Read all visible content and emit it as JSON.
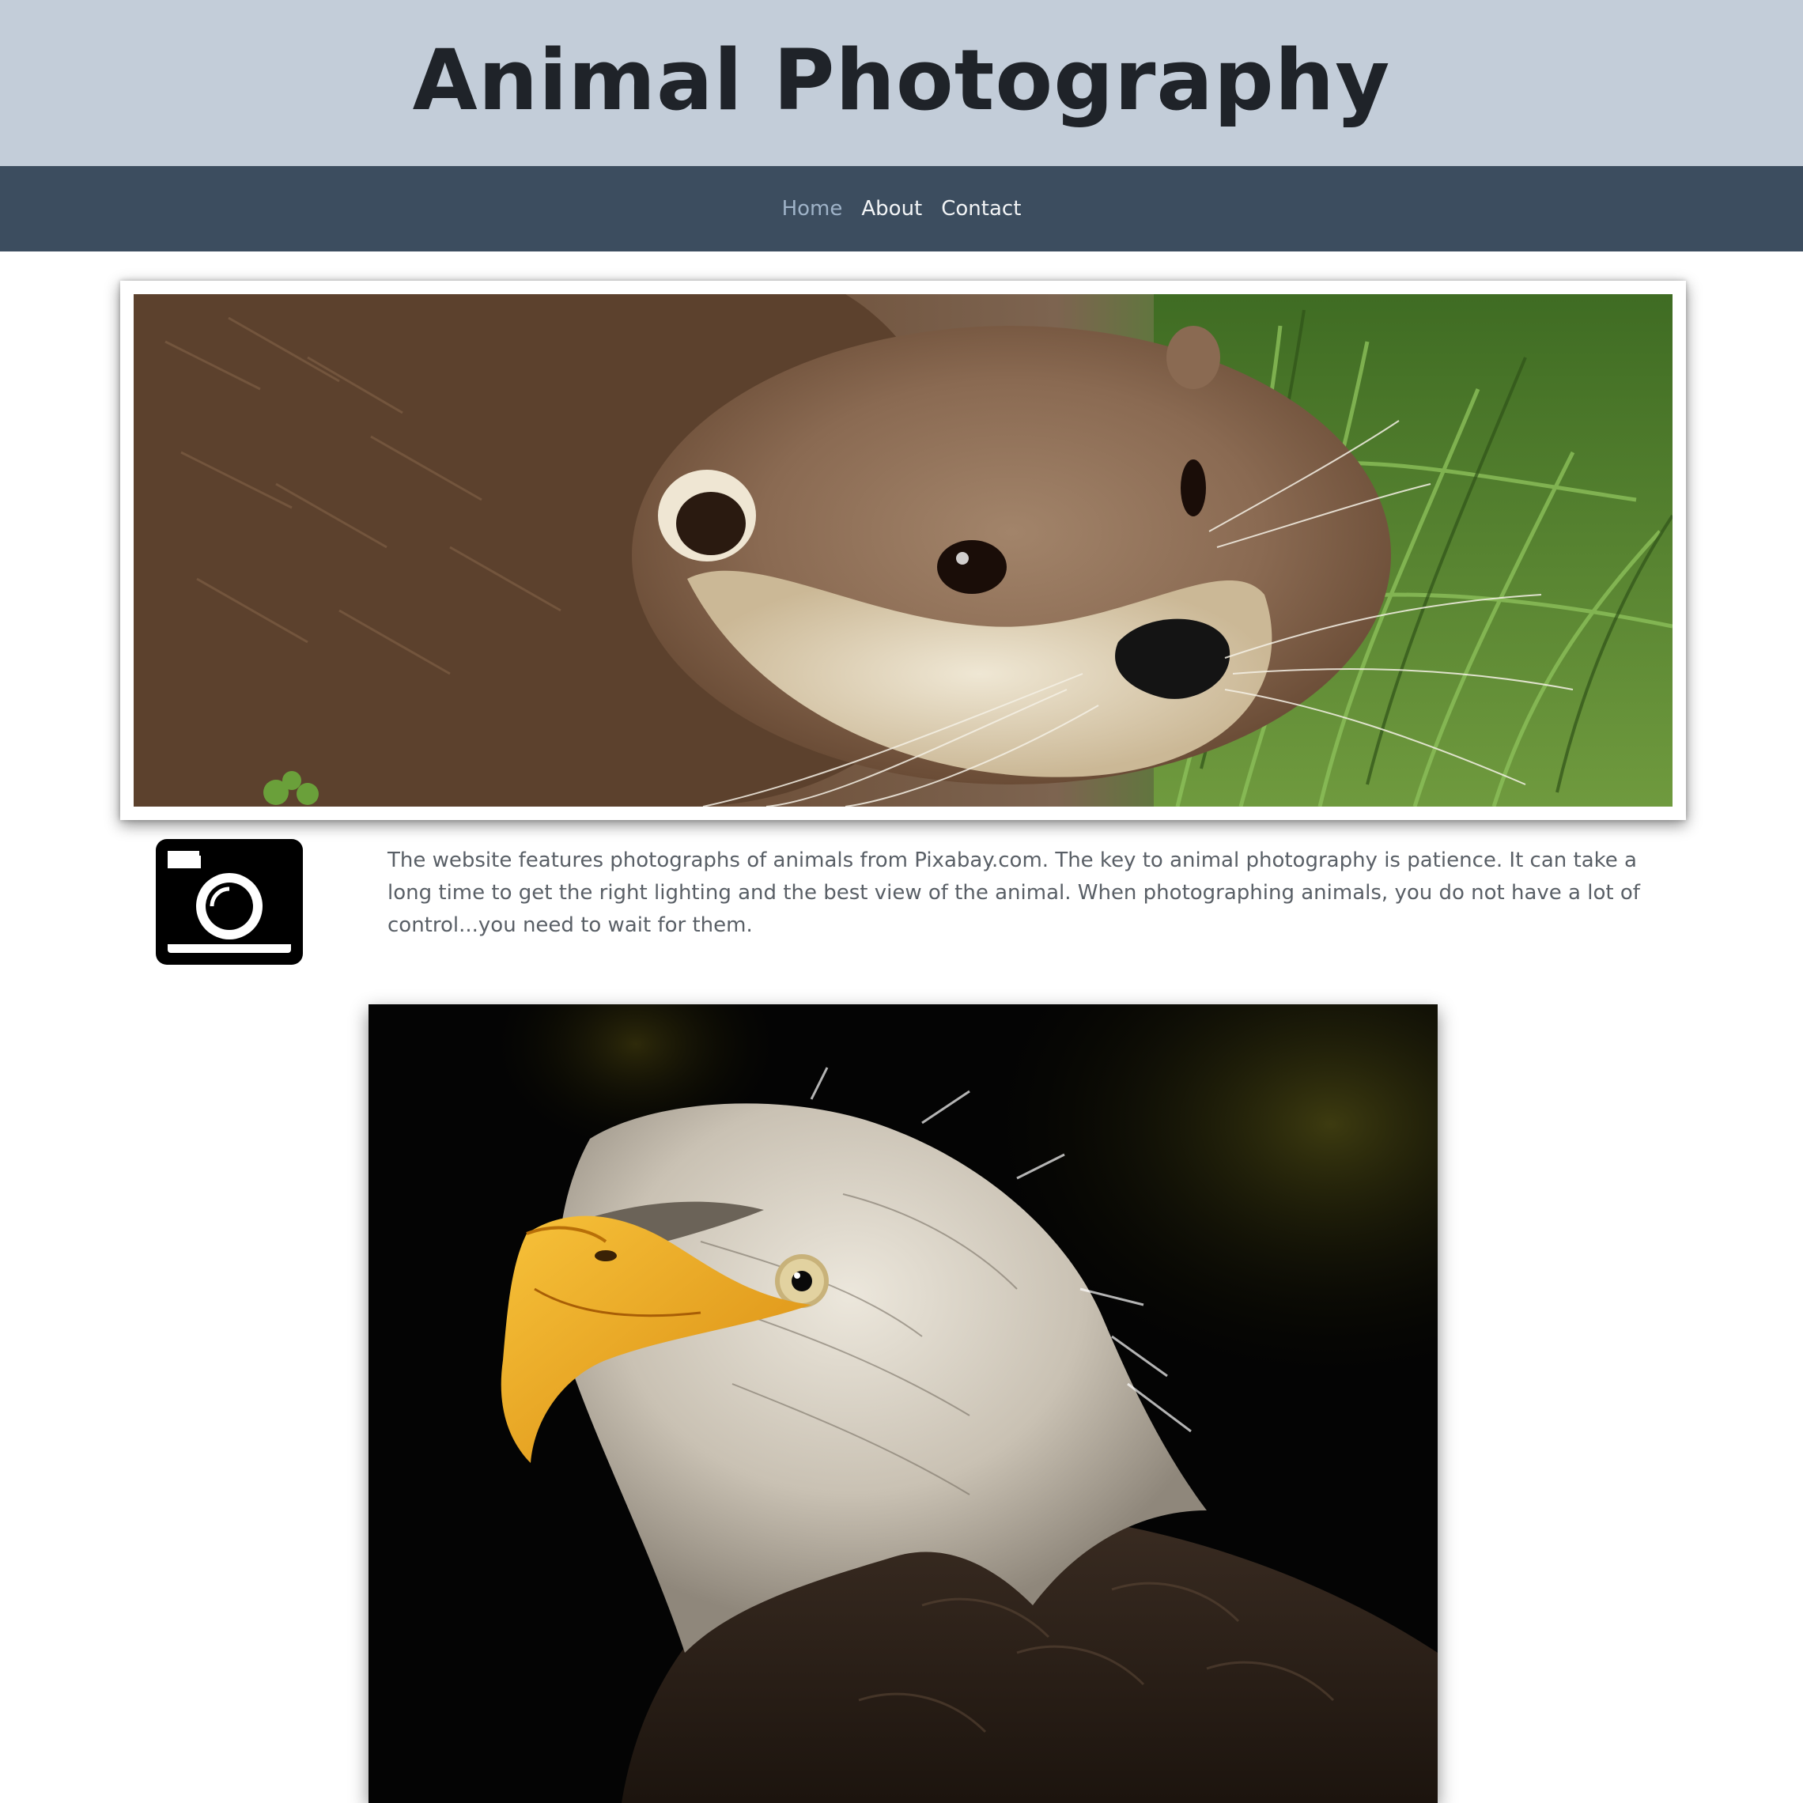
{
  "header": {
    "title": "Animal Photography"
  },
  "nav": {
    "items": [
      {
        "label": "Home",
        "active": true
      },
      {
        "label": "About",
        "active": false
      },
      {
        "label": "Contact",
        "active": false
      }
    ]
  },
  "intro": {
    "icon": "camera-icon",
    "text": "The website features photographs of animals from Pixabay.com. The key to animal photography is patience. It can take a long time to get the right lighting and the best view of the animal. When photographing animals, you do not have a lot of control...you need to wait for them."
  },
  "colors": {
    "header_bg": "#c3cdd9",
    "nav_bg": "#3c4d5f",
    "nav_active": "#9fb3c8",
    "title": "#1f2329",
    "body_text": "#595f66"
  }
}
